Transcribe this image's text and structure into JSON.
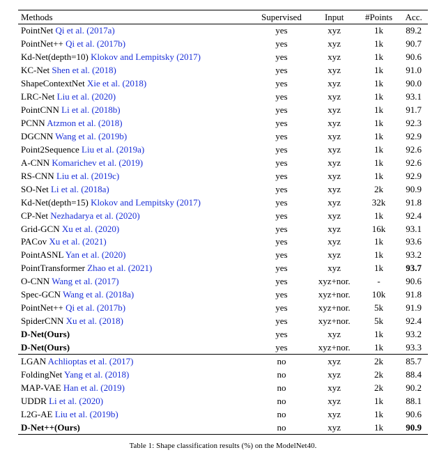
{
  "chart_data": {
    "type": "table",
    "title": "Table 1: Shape classification results (%) on the ModelNet40.",
    "columns": [
      "Methods",
      "Supervised",
      "Input",
      "#Points",
      "Acc."
    ],
    "sections": [
      {
        "rows": [
          {
            "method": "PointNet",
            "cite": "Qi et al. (2017a)",
            "supervised": "yes",
            "input": "xyz",
            "points": "1k",
            "acc": "89.2"
          },
          {
            "method": "PointNet++",
            "cite": "Qi et al. (2017b)",
            "supervised": "yes",
            "input": "xyz",
            "points": "1k",
            "acc": "90.7"
          },
          {
            "method": "Kd-Net(depth=10)",
            "cite": "Klokov and Lempitsky (2017)",
            "supervised": "yes",
            "input": "xyz",
            "points": "1k",
            "acc": "90.6"
          },
          {
            "method": "KC-Net",
            "cite": "Shen et al. (2018)",
            "supervised": "yes",
            "input": "xyz",
            "points": "1k",
            "acc": "91.0"
          },
          {
            "method": "ShapeContextNet",
            "cite": "Xie et al. (2018)",
            "supervised": "yes",
            "input": "xyz",
            "points": "1k",
            "acc": "90.0"
          },
          {
            "method": "LRC-Net",
            "cite": "Liu et al. (2020)",
            "supervised": "yes",
            "input": "xyz",
            "points": "1k",
            "acc": "93.1"
          },
          {
            "method": "PointCNN",
            "cite": "Li et al. (2018b)",
            "supervised": "yes",
            "input": "xyz",
            "points": "1k",
            "acc": "91.7"
          },
          {
            "method": "PCNN",
            "cite": "Atzmon et al. (2018)",
            "supervised": "yes",
            "input": "xyz",
            "points": "1k",
            "acc": "92.3"
          },
          {
            "method": "DGCNN",
            "cite": "Wang et al. (2019b)",
            "supervised": "yes",
            "input": "xyz",
            "points": "1k",
            "acc": "92.9"
          },
          {
            "method": "Point2Sequence",
            "cite": "Liu et al. (2019a)",
            "supervised": "yes",
            "input": "xyz",
            "points": "1k",
            "acc": "92.6"
          },
          {
            "method": "A-CNN",
            "cite": "Komarichev et al. (2019)",
            "supervised": "yes",
            "input": "xyz",
            "points": "1k",
            "acc": "92.6"
          },
          {
            "method": "RS-CNN",
            "cite": "Liu et al. (2019c)",
            "supervised": "yes",
            "input": "xyz",
            "points": "1k",
            "acc": "92.9"
          },
          {
            "method": "SO-Net",
            "cite": "Li et al. (2018a)",
            "supervised": "yes",
            "input": "xyz",
            "points": "2k",
            "acc": "90.9"
          },
          {
            "method": "Kd-Net(depth=15)",
            "cite": "Klokov and Lempitsky (2017)",
            "supervised": "yes",
            "input": "xyz",
            "points": "32k",
            "acc": "91.8"
          },
          {
            "method": "CP-Net",
            "cite": "Nezhadarya et al. (2020)",
            "supervised": "yes",
            "input": "xyz",
            "points": "1k",
            "acc": "92.4"
          },
          {
            "method": "Grid-GCN",
            "cite": "Xu et al. (2020)",
            "supervised": "yes",
            "input": "xyz",
            "points": "16k",
            "acc": "93.1"
          },
          {
            "method": "PACov",
            "cite": "Xu et al. (2021)",
            "supervised": "yes",
            "input": "xyz",
            "points": "1k",
            "acc": "93.6"
          },
          {
            "method": "PointASNL",
            "cite": "Yan et al. (2020)",
            "supervised": "yes",
            "input": "xyz",
            "points": "1k",
            "acc": "93.2"
          },
          {
            "method": "PointTransformer",
            "cite": "Zhao et al. (2021)",
            "supervised": "yes",
            "input": "xyz",
            "points": "1k",
            "acc": "93.7",
            "acc_bold": true
          },
          {
            "method": "O-CNN",
            "cite": "Wang et al. (2017)",
            "supervised": "yes",
            "input": "xyz+nor.",
            "points": "-",
            "acc": "90.6"
          },
          {
            "method": "Spec-GCN",
            "cite": "Wang et al. (2018a)",
            "supervised": "yes",
            "input": "xyz+nor.",
            "points": "10k",
            "acc": "91.8"
          },
          {
            "method": "PointNet++",
            "cite": "Qi et al. (2017b)",
            "supervised": "yes",
            "input": "xyz+nor.",
            "points": "5k",
            "acc": "91.9"
          },
          {
            "method": "SpiderCNN",
            "cite": "Xu et al. (2018)",
            "supervised": "yes",
            "input": "xyz+nor.",
            "points": "5k",
            "acc": "92.4"
          },
          {
            "method": "D-Net(Ours)",
            "method_bold": true,
            "supervised": "yes",
            "input": "xyz",
            "points": "1k",
            "acc": "93.2"
          },
          {
            "method": "D-Net(Ours)",
            "method_bold": true,
            "supervised": "yes",
            "input": "xyz+nor.",
            "points": "1k",
            "acc": "93.3"
          }
        ]
      },
      {
        "rows": [
          {
            "method": "LGAN",
            "cite": "Achlioptas et al. (2017)",
            "supervised": "no",
            "input": "xyz",
            "points": "2k",
            "acc": "85.7"
          },
          {
            "method": "FoldingNet",
            "cite": "Yang et al. (2018)",
            "supervised": "no",
            "input": "xyz",
            "points": "2k",
            "acc": "88.4"
          },
          {
            "method": "MAP-VAE",
            "cite": "Han et al. (2019)",
            "supervised": "no",
            "input": "xyz",
            "points": "2k",
            "acc": "90.2"
          },
          {
            "method": "UDDR",
            "cite": "Li et al. (2020)",
            "supervised": "no",
            "input": "xyz",
            "points": "1k",
            "acc": "88.1"
          },
          {
            "method": "L2G-AE",
            "cite": "Liu et al. (2019b)",
            "supervised": "no",
            "input": "xyz",
            "points": "1k",
            "acc": "90.6"
          },
          {
            "method": "D-Net++(Ours)",
            "method_bold": true,
            "supervised": "no",
            "input": "xyz",
            "points": "1k",
            "acc": "90.9",
            "acc_bold": true
          }
        ]
      }
    ]
  }
}
